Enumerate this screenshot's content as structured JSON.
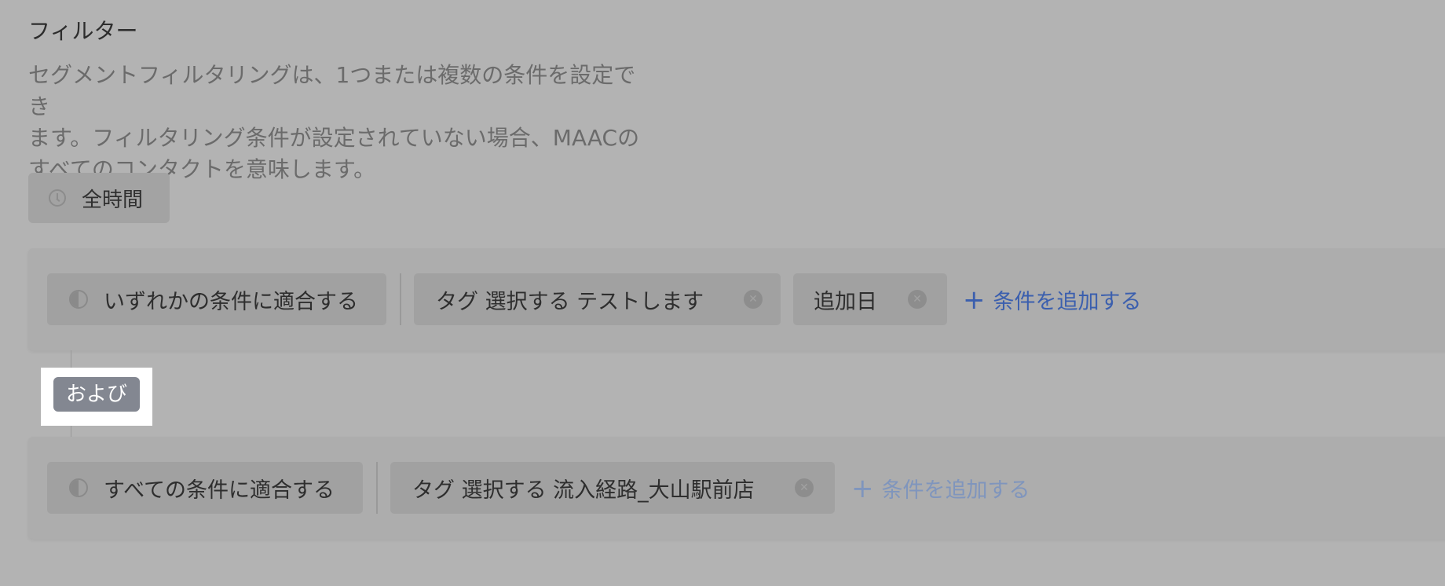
{
  "filter": {
    "title": "フィルター",
    "description": "セグメントフィルタリングは、1つまたは複数の条件を設定でき\nます。フィルタリング条件が設定されていない場合、MAACの\nすべてのコンタクトを意味します。"
  },
  "time_range": {
    "label": "全時間",
    "icon": "clock-icon"
  },
  "group1": {
    "match_label": "いずれかの条件に適合する",
    "conditions": [
      {
        "label": "タグ  選択する  テストします"
      },
      {
        "label": "追加日"
      }
    ],
    "add_label": "条件を追加する",
    "add_color": "#3b5fae"
  },
  "connector": {
    "label": "および"
  },
  "group2": {
    "match_label": "すべての条件に適合する",
    "conditions": [
      {
        "label": "タグ  選択する  流入経路_大山駅前店"
      }
    ],
    "add_label": "条件を追加する",
    "add_color": "#7f95bd"
  }
}
